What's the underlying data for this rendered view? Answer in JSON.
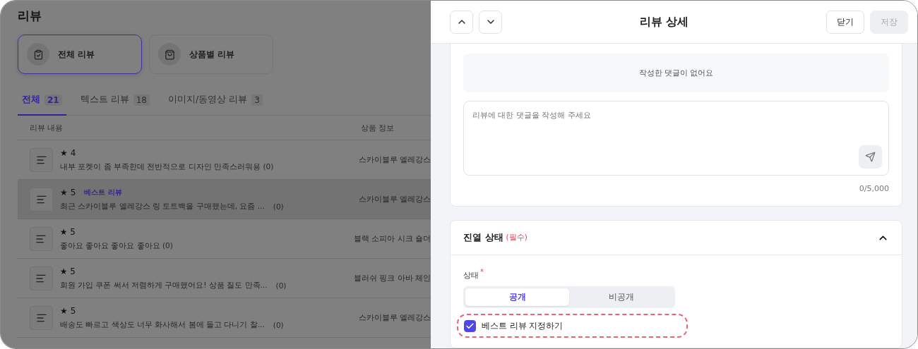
{
  "page": {
    "title": "리뷰",
    "view_cards": [
      {
        "label": "전체 리뷰",
        "selected": true
      },
      {
        "label": "상품별 리뷰",
        "selected": false
      }
    ],
    "tabs": [
      {
        "label": "전체",
        "count": "21",
        "selected": true
      },
      {
        "label": "텍스트 리뷰",
        "count": "18",
        "selected": false
      },
      {
        "label": "이미지/동영상 리뷰",
        "count": "3",
        "selected": false
      }
    ],
    "table": {
      "columns": [
        "리뷰 내용",
        "상품 정보"
      ],
      "rows": [
        {
          "rating": "★ 4",
          "text": "내부 포켓이 좀 부족한데 전반적으로 디자인 만족스러워용 (0)",
          "product": "스카이블루 엘레강스",
          "selected": false
        },
        {
          "rating": "★ 5",
          "badge": "베스트 리뷰",
          "text": "최근 스카이블루 엘레강스 링 토트백을 구매했는데, 요즘 ...",
          "comments": "(0)",
          "product": "스카이블루 엘레강스",
          "selected": true
        },
        {
          "rating": "★ 5",
          "text": "좋아요 좋아요 좋아요 좋아요 (0)",
          "product": "블랙 소피아 시크 숄더",
          "selected": false
        },
        {
          "rating": "★ 5",
          "text": "회원 가입 쿠폰 써서 저렴하게 구매했어요! 상품 질도 만족...",
          "comments": "(0)",
          "product": "블러쉬 핑크 아바 체인",
          "selected": false
        },
        {
          "rating": "★ 5",
          "text": "배송도 빠르고 색상도 너무 화사해서 봄에 들고 다니기 찰...",
          "comments": "(0)",
          "product": "스카이블루 엘레강스",
          "selected": false
        }
      ]
    }
  },
  "drawer": {
    "title": "리뷰 상세",
    "close_button": "닫기",
    "save_button": {
      "label": "저장",
      "disabled": true
    },
    "comments": {
      "empty_message": "작성한 댓글이 없어요",
      "placeholder": "리뷰에 대한 댓글을 작성해 주세요",
      "counter": "0/5,000"
    },
    "display_section": {
      "title": "진열 상태",
      "required_note": "(필수)",
      "expanded": true,
      "status_label": "상태",
      "required_mark": "*",
      "options": [
        {
          "label": "공개",
          "selected": true
        },
        {
          "label": "비공개",
          "selected": false
        }
      ],
      "best_review": {
        "label": "베스트 리뷰 지정하기",
        "checked": true,
        "highlighted": true
      }
    }
  }
}
